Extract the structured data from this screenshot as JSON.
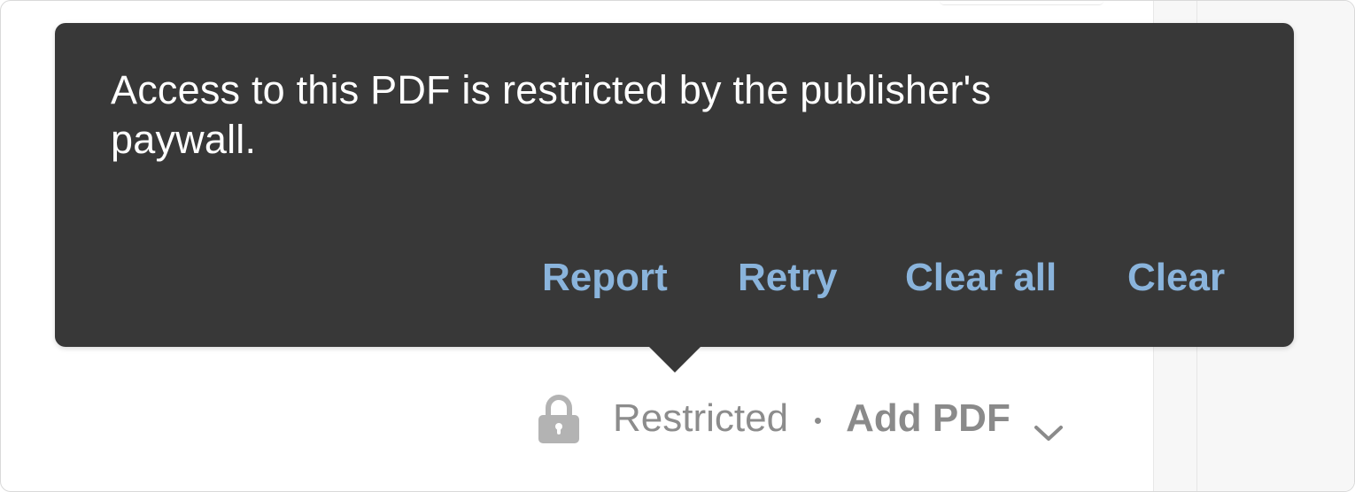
{
  "tooltip": {
    "message": "Access to this PDF is restricted by the publisher's paywall.",
    "actions": {
      "report": "Report",
      "retry": "Retry",
      "clear_all": "Clear all",
      "clear": "Clear"
    }
  },
  "status": {
    "lock_icon": "lock-icon",
    "label": "Restricted",
    "add_pdf": "Add PDF",
    "dropdown_icon": "chevron-down-icon"
  },
  "colors": {
    "tooltip_bg": "#383838",
    "tooltip_text": "#ffffff",
    "action_link": "#8ab4dc",
    "status_text": "#8a8a8a"
  }
}
